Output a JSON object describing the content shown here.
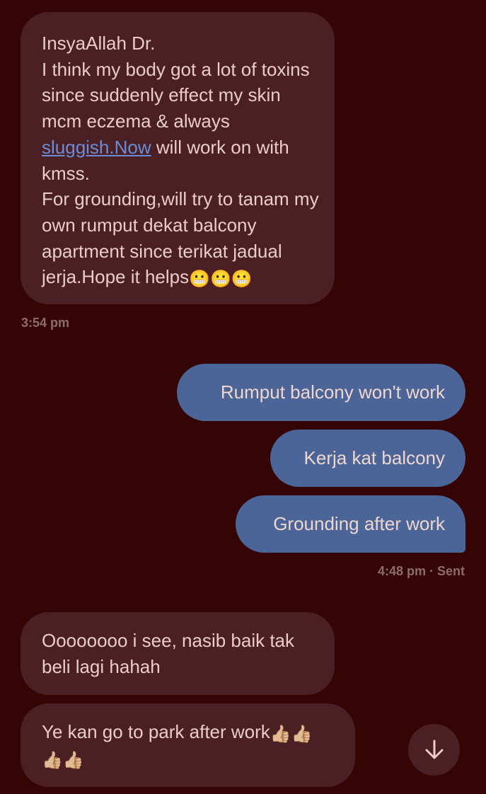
{
  "messages": [
    {
      "direction": "incoming",
      "text_before": "InsyaAllah Dr.\nI think my body got a lot of toxins since suddenly effect my skin mcm eczema & always ",
      "link": "sluggish.Now",
      "text_after": " will work on with kmss.\nFor grounding,will try to tanam my own rumput dekat balcony apartment since terikat jadual jerja.Hope it helps",
      "emoji": "😬😬😬",
      "timestamp": "3:54 pm"
    },
    {
      "direction": "outgoing",
      "text": "Rumput balcony won't work"
    },
    {
      "direction": "outgoing",
      "text": "Kerja kat balcony"
    },
    {
      "direction": "outgoing",
      "text": "Grounding after work",
      "timestamp": "4:48 pm · Sent"
    },
    {
      "direction": "incoming",
      "text": "Oooooooo i see, nasib baik tak beli lagi hahah"
    },
    {
      "direction": "incoming",
      "text": "Ye kan go to park after work",
      "emoji_a": "👍🏼👍🏼",
      "emoji_b": "👍🏼👍🏼"
    }
  ],
  "scroll_button": {
    "icon": "arrow-down-icon"
  },
  "colors": {
    "background": "#350404",
    "incoming_bubble": "#4b2024",
    "outgoing_bubble": "#4b6598",
    "link": "#6b8cd6",
    "timestamp": "#8d6d69"
  }
}
